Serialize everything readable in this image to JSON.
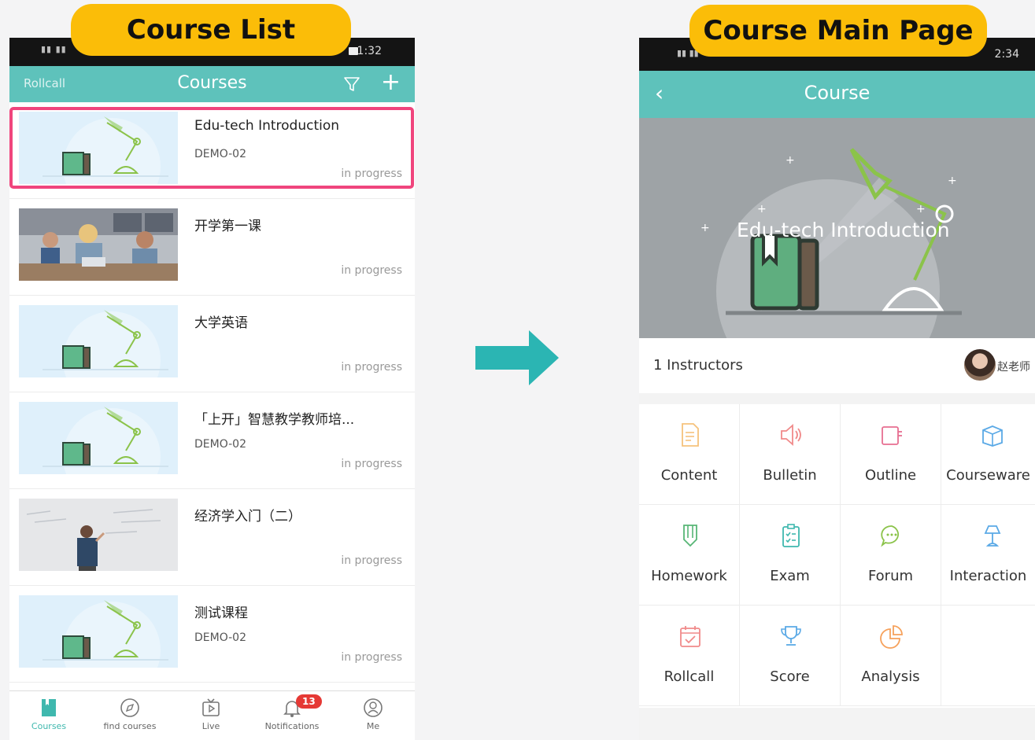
{
  "labels": {
    "left": "Course List",
    "right": "Course Main Page"
  },
  "left_phone": {
    "status_time": "1:32",
    "nav": {
      "left_link": "Rollcall",
      "title": "Courses",
      "plus": "+"
    },
    "courses": [
      {
        "name": "Edu-tech Introduction",
        "code": "DEMO-02",
        "status": "in progress",
        "thumb": "lamp"
      },
      {
        "name": "开学第一课",
        "code": "",
        "status": "in progress",
        "thumb": "classroom"
      },
      {
        "name": "大学英语",
        "code": "",
        "status": "in progress",
        "thumb": "lamp"
      },
      {
        "name": "「上开」智慧教学教师培...",
        "code": "DEMO-02",
        "status": "in progress",
        "thumb": "lamp"
      },
      {
        "name": "经济学入门（二）",
        "code": "",
        "status": "in progress",
        "thumb": "whiteboard"
      },
      {
        "name": "测试课程",
        "code": "DEMO-02",
        "status": "in progress",
        "thumb": "lamp"
      }
    ],
    "tabbar": [
      {
        "label": "Courses",
        "icon": "book-icon"
      },
      {
        "label": "find courses",
        "icon": "compass-icon"
      },
      {
        "label": "Live",
        "icon": "tv-icon"
      },
      {
        "label": "Notifications",
        "icon": "bell-icon",
        "badge": "13"
      },
      {
        "label": "Me",
        "icon": "user-icon"
      }
    ],
    "accent": "#5ec2bb",
    "highlight_color": "#f0457d"
  },
  "right_phone": {
    "status_time": "2:34",
    "nav": {
      "back": "‹",
      "title": "Course"
    },
    "banner_title": "Edu-tech Introduction",
    "instructors": {
      "count": "1 Instructors",
      "name": "赵老师"
    },
    "menu": [
      {
        "label": "Content",
        "icon": "document-icon"
      },
      {
        "label": "Bulletin",
        "icon": "speaker-icon"
      },
      {
        "label": "Outline",
        "icon": "outline-icon"
      },
      {
        "label": "Courseware",
        "icon": "box-icon"
      },
      {
        "label": "Homework",
        "icon": "pencil-icon"
      },
      {
        "label": "Exam",
        "icon": "clipboard-icon"
      },
      {
        "label": "Forum",
        "icon": "chat-icon"
      },
      {
        "label": "Interaction",
        "icon": "lamp-icon"
      },
      {
        "label": "Rollcall",
        "icon": "calendar-icon"
      },
      {
        "label": "Score",
        "icon": "trophy-icon"
      },
      {
        "label": "Analysis",
        "icon": "pie-icon"
      }
    ]
  }
}
